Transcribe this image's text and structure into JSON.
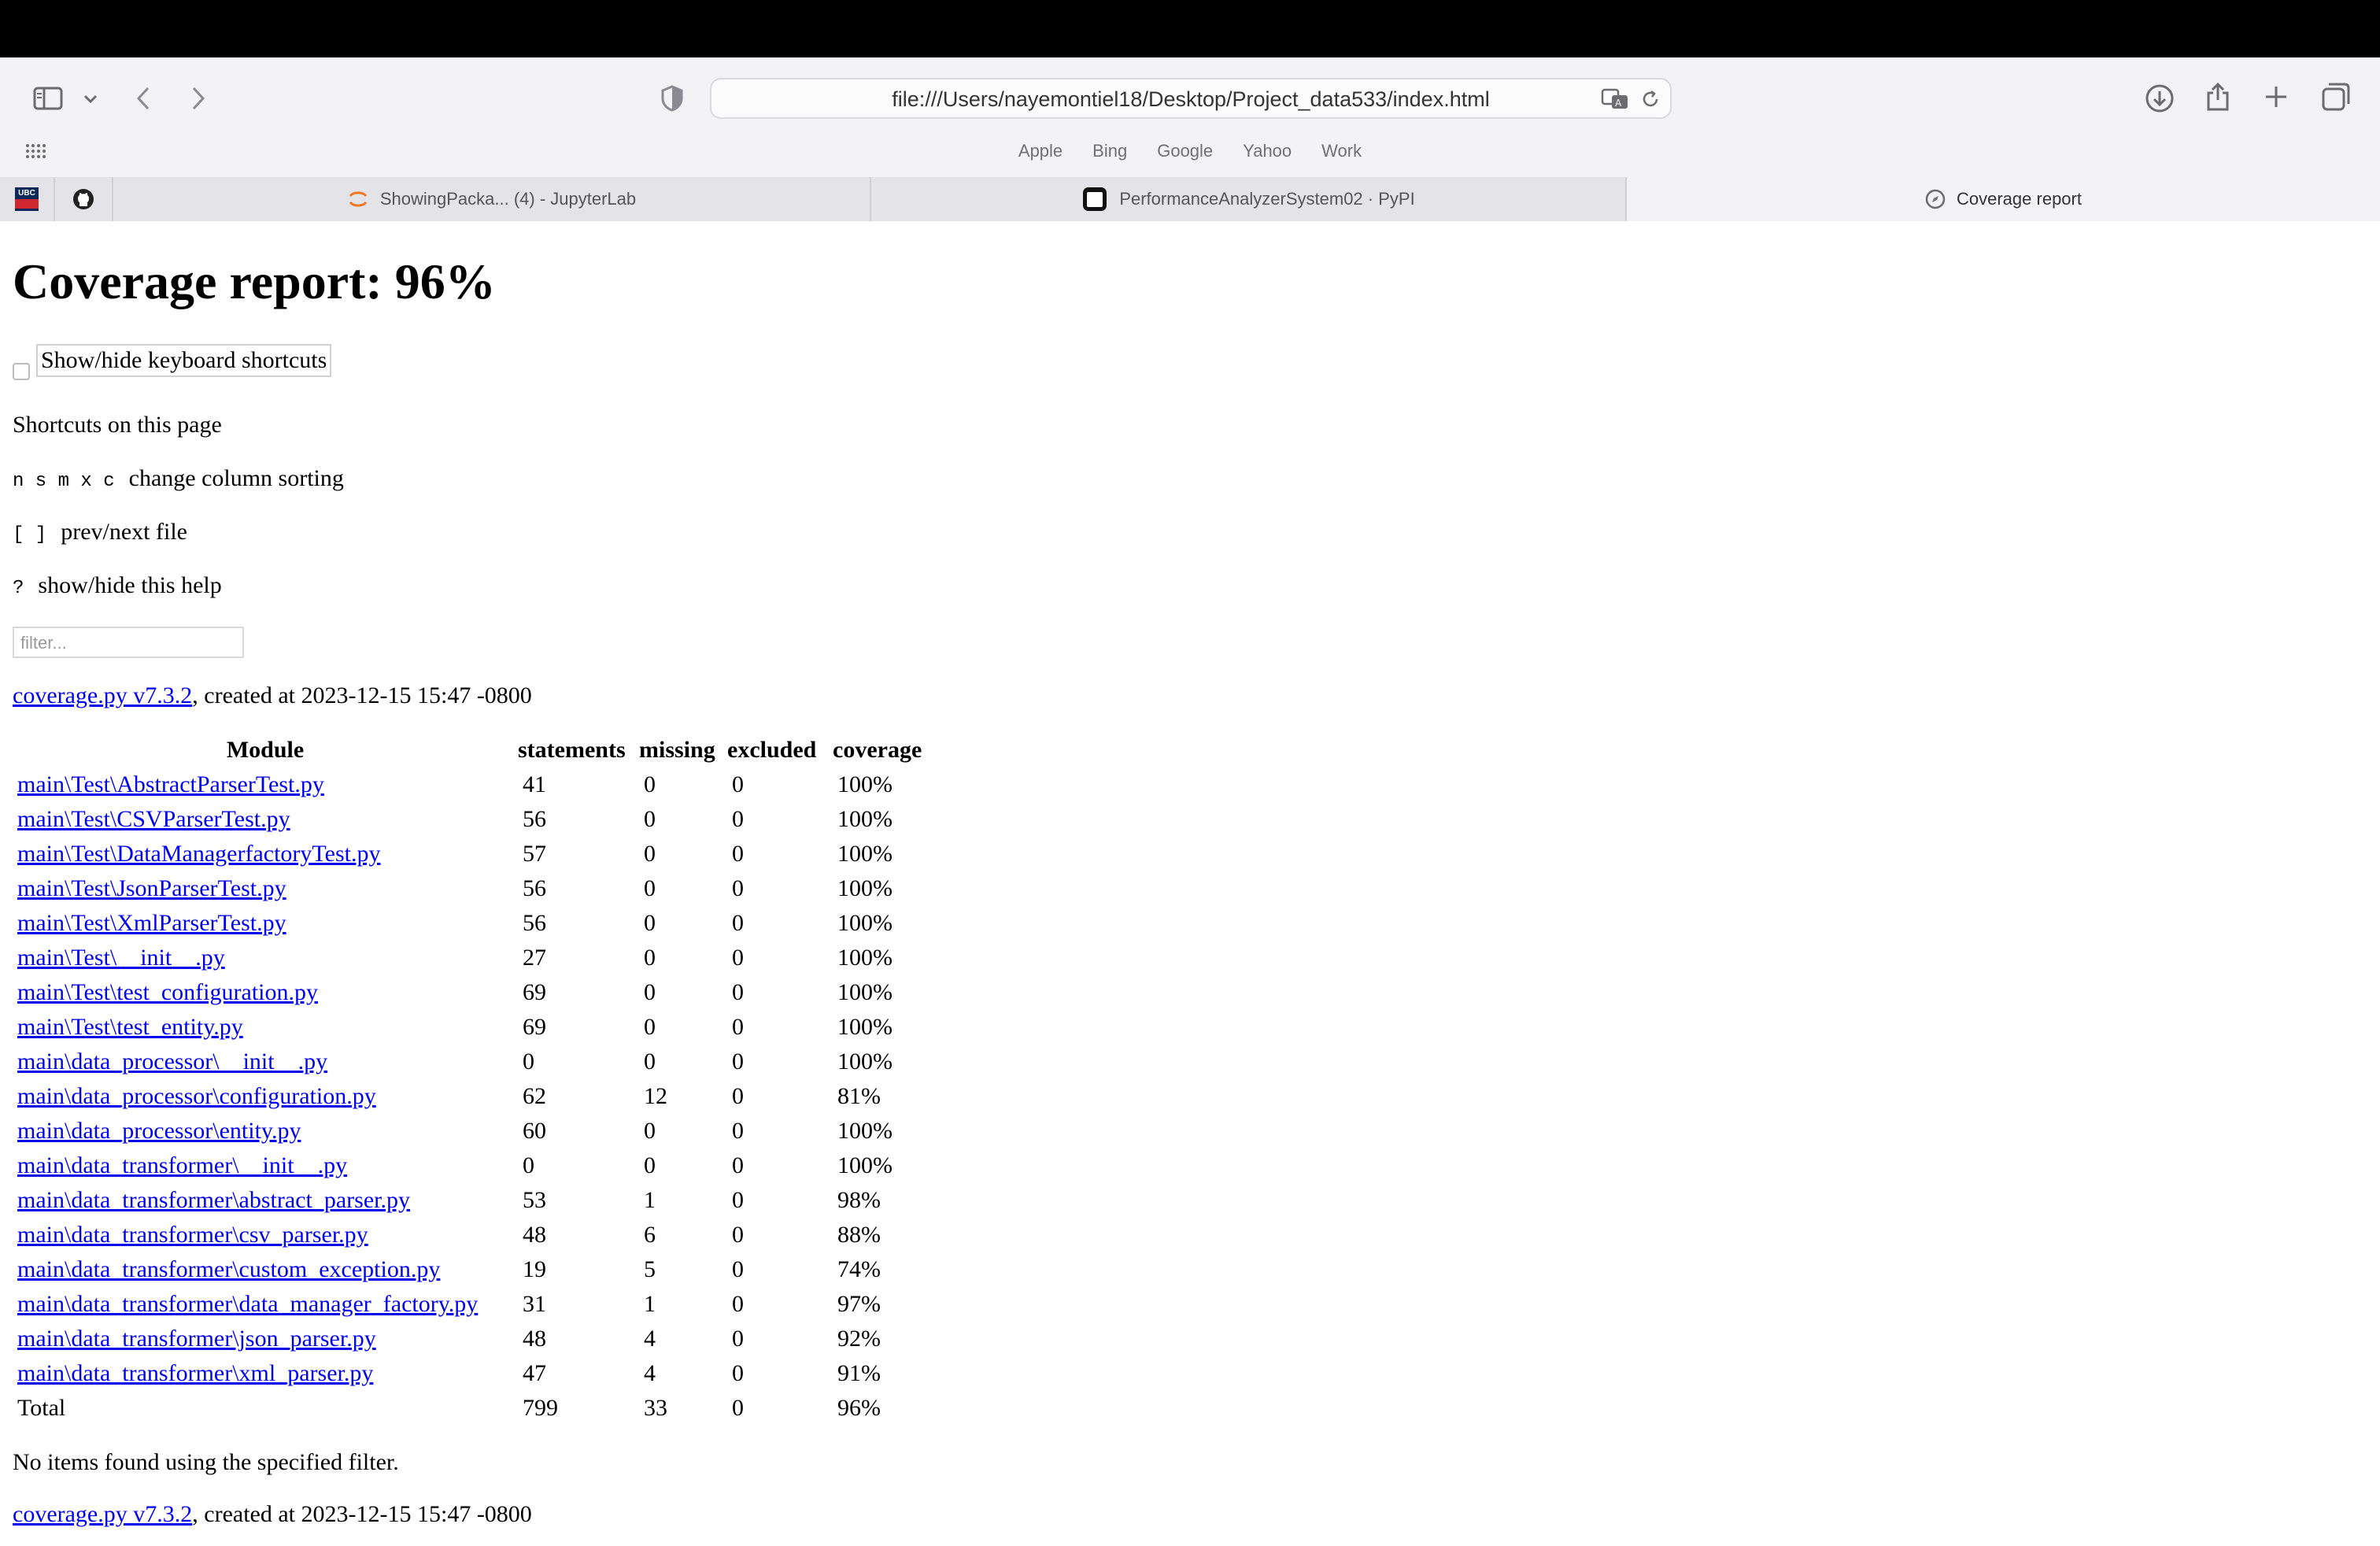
{
  "browser": {
    "url": "file:///Users/nayemontiel18/Desktop/Project_data533/index.html",
    "favorites": [
      "Apple",
      "Bing",
      "Google",
      "Yahoo",
      "Work"
    ],
    "tabs": [
      {
        "label": "ShowingPacka... (4) - JupyterLab"
      },
      {
        "label": "PerformanceAnalyzerSystem02 · PyPI"
      },
      {
        "label": "Coverage report"
      }
    ],
    "pinned_ubc": "UBC"
  },
  "page": {
    "title": "Coverage report: 96%",
    "shortcuts_button": "Show/hide keyboard shortcuts",
    "shortcuts_heading": "Shortcuts on this page",
    "shortcuts": [
      {
        "keys": "n s m x c",
        "desc": "change column sorting"
      },
      {
        "keys": "[ ]",
        "desc": "prev/next file"
      },
      {
        "keys": "?",
        "desc": "show/hide this help"
      }
    ],
    "filter_placeholder": "filter...",
    "footer_link": "coverage.py v7.3.2",
    "footer_rest": ", created at 2023-12-15 15:47 -0800",
    "no_items": "No items found using the specified filter."
  },
  "table": {
    "headers": [
      "Module",
      "statements",
      "missing",
      "excluded",
      "coverage"
    ],
    "rows": [
      [
        "main\\Test\\AbstractParserTest.py",
        "41",
        "0",
        "0",
        "100%"
      ],
      [
        "main\\Test\\CSVParserTest.py",
        "56",
        "0",
        "0",
        "100%"
      ],
      [
        "main\\Test\\DataManagerfactoryTest.py",
        "57",
        "0",
        "0",
        "100%"
      ],
      [
        "main\\Test\\JsonParserTest.py",
        "56",
        "0",
        "0",
        "100%"
      ],
      [
        "main\\Test\\XmlParserTest.py",
        "56",
        "0",
        "0",
        "100%"
      ],
      [
        "main\\Test\\__init__.py",
        "27",
        "0",
        "0",
        "100%"
      ],
      [
        "main\\Test\\test_configuration.py",
        "69",
        "0",
        "0",
        "100%"
      ],
      [
        "main\\Test\\test_entity.py",
        "69",
        "0",
        "0",
        "100%"
      ],
      [
        "main\\data_processor\\__init__.py",
        "0",
        "0",
        "0",
        "100%"
      ],
      [
        "main\\data_processor\\configuration.py",
        "62",
        "12",
        "0",
        "81%"
      ],
      [
        "main\\data_processor\\entity.py",
        "60",
        "0",
        "0",
        "100%"
      ],
      [
        "main\\data_transformer\\__init__.py",
        "0",
        "0",
        "0",
        "100%"
      ],
      [
        "main\\data_transformer\\abstract_parser.py",
        "53",
        "1",
        "0",
        "98%"
      ],
      [
        "main\\data_transformer\\csv_parser.py",
        "48",
        "6",
        "0",
        "88%"
      ],
      [
        "main\\data_transformer\\custom_exception.py",
        "19",
        "5",
        "0",
        "74%"
      ],
      [
        "main\\data_transformer\\data_manager_factory.py",
        "31",
        "1",
        "0",
        "97%"
      ],
      [
        "main\\data_transformer\\json_parser.py",
        "48",
        "4",
        "0",
        "92%"
      ],
      [
        "main\\data_transformer\\xml_parser.py",
        "47",
        "4",
        "0",
        "91%"
      ]
    ],
    "total": [
      "Total",
      "799",
      "33",
      "0",
      "96%"
    ]
  }
}
